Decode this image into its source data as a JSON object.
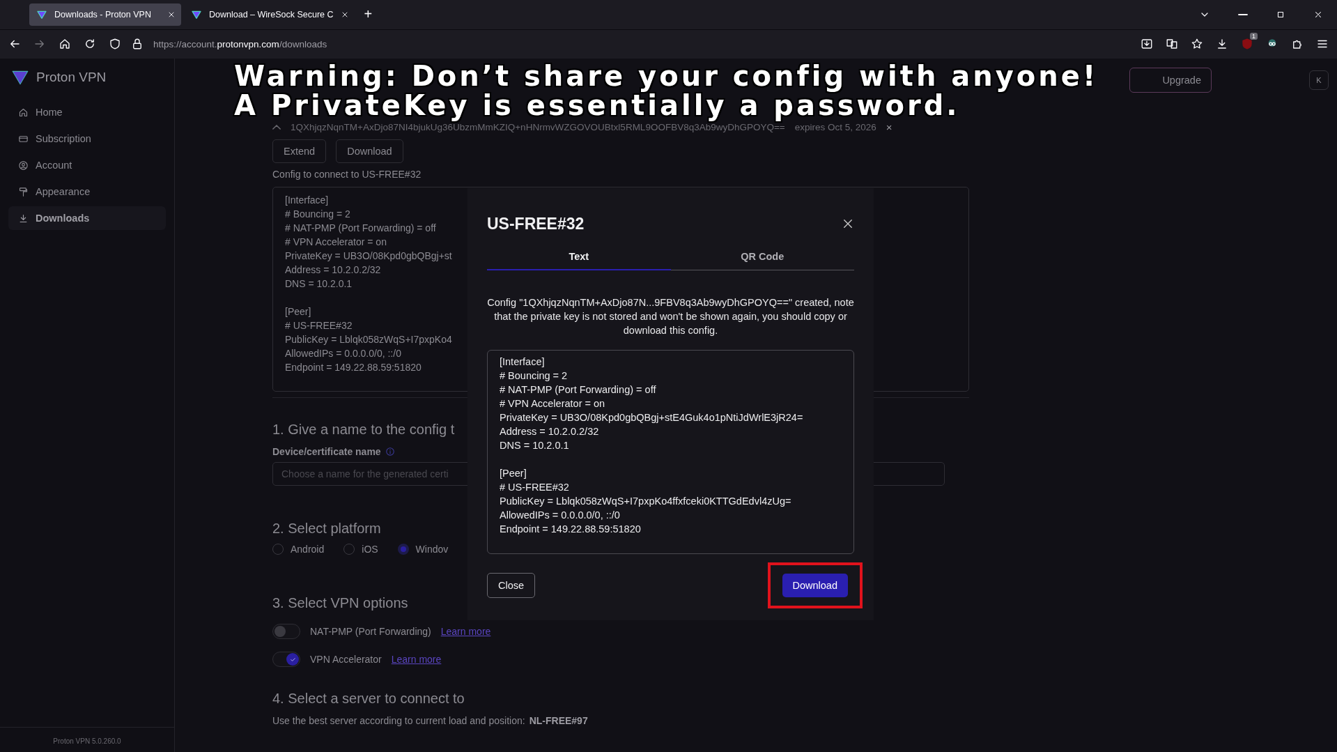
{
  "browser": {
    "tabs": [
      {
        "title": "Downloads - Proton VPN",
        "selected": true
      },
      {
        "title": "Download – WireSock Secure C",
        "selected": false
      }
    ],
    "new_tab": "+",
    "url": {
      "scheme": "https://account.",
      "host": "protonvpn.com",
      "path": "/downloads"
    },
    "extension_badge": "1"
  },
  "sidebar": {
    "brand": "Proton VPN",
    "items": [
      {
        "label": "Home",
        "kind": "home",
        "selected": false
      },
      {
        "label": "Subscription",
        "kind": "card",
        "selected": false
      },
      {
        "label": "Account",
        "kind": "user",
        "selected": false
      },
      {
        "label": "Appearance",
        "kind": "brush",
        "selected": false
      },
      {
        "label": "Downloads",
        "kind": "download",
        "selected": true
      }
    ],
    "version": "Proton VPN 5.0.260.0"
  },
  "header": {
    "upgrade": "Upgrade",
    "user_initial": "K"
  },
  "config_entry": {
    "key": "1QXhjqzNqnTM+AxDjo87NI4bjukUg36UbzmMmKZIQ+nHNrmvWZGOVOUBtxl5RML9OOFBV8q3Ab9wyDhGPOYQ==",
    "expires": "expires Oct 5, 2026",
    "remove": "×",
    "buttons": [
      "Extend",
      "Download"
    ],
    "caption": "Config to connect to US-FREE#32",
    "sections": [
      {
        "lines": [
          "[Interface]",
          "# Bouncing = 2",
          "# NAT-PMP (Port Forwarding) = off",
          "# VPN Accelerator = on",
          "PrivateKey = UB3O/08Kpd0gbQBgj+st",
          "Address = 10.2.0.2/32",
          "DNS = 10.2.0.1"
        ]
      },
      {
        "lines": [
          "[Peer]",
          "# US-FREE#32",
          "PublicKey = Lblqk058zWqS+I7pxpKo4",
          "AllowedIPs = 0.0.0.0/0, ::/0",
          "Endpoint = 149.22.88.59:51820"
        ]
      }
    ]
  },
  "form": {
    "step1": {
      "title": "1. Give a name to the config t",
      "label": "Device/certificate name",
      "placeholder": "Choose a name for the generated certi"
    },
    "step2": {
      "title": "2. Select platform",
      "options": [
        {
          "label": "Android",
          "selected": false
        },
        {
          "label": "iOS",
          "selected": false
        },
        {
          "label": "Windov",
          "selected": true
        }
      ]
    },
    "step3": {
      "title": "3. Select VPN options",
      "options": [
        {
          "label": "NAT-PMP (Port Forwarding)",
          "on": false,
          "link": "Learn more"
        },
        {
          "label": "VPN Accelerator",
          "on": true,
          "link": "Learn more"
        }
      ]
    },
    "step4": {
      "title": "4. Select a server to connect to",
      "text": "Use the best server according to current load and position:",
      "server": "NL-FREE#97"
    }
  },
  "modal": {
    "title": "US-FREE#32",
    "tabs": [
      {
        "label": "Text",
        "selected": true
      },
      {
        "label": "QR Code",
        "selected": false
      }
    ],
    "message": "Config \"1QXhjqzNqnTM+AxDjo87N...9FBV8q3Ab9wyDhGPOYQ==\" created, note that the private key is not stored and won't be shown again, you should copy or download this config.",
    "sections": [
      {
        "lines": [
          "[Interface]",
          "# Bouncing = 2",
          "# NAT-PMP (Port Forwarding) = off",
          "# VPN Accelerator = on",
          "PrivateKey = UB3O/08Kpd0gbQBgj+stE4Guk4o1pNtiJdWrlE3jR24=",
          "Address = 10.2.0.2/32",
          "DNS = 10.2.0.1"
        ]
      },
      {
        "lines": [
          "[Peer]",
          "# US-FREE#32",
          "PublicKey = Lblqk058zWqS+I7pxpKo4ffxfceki0KTTGdEdvl4zUg=",
          "AllowedIPs = 0.0.0.0/0, ::/0",
          "Endpoint = 149.22.88.59:51820"
        ]
      }
    ],
    "close_button": "Close",
    "download_button": "Download",
    "download_highlighted": true
  },
  "caption": {
    "lines": [
      "Warning: Don’t share your config with anyone!",
      "A PrivateKey is essentially a password."
    ]
  }
}
